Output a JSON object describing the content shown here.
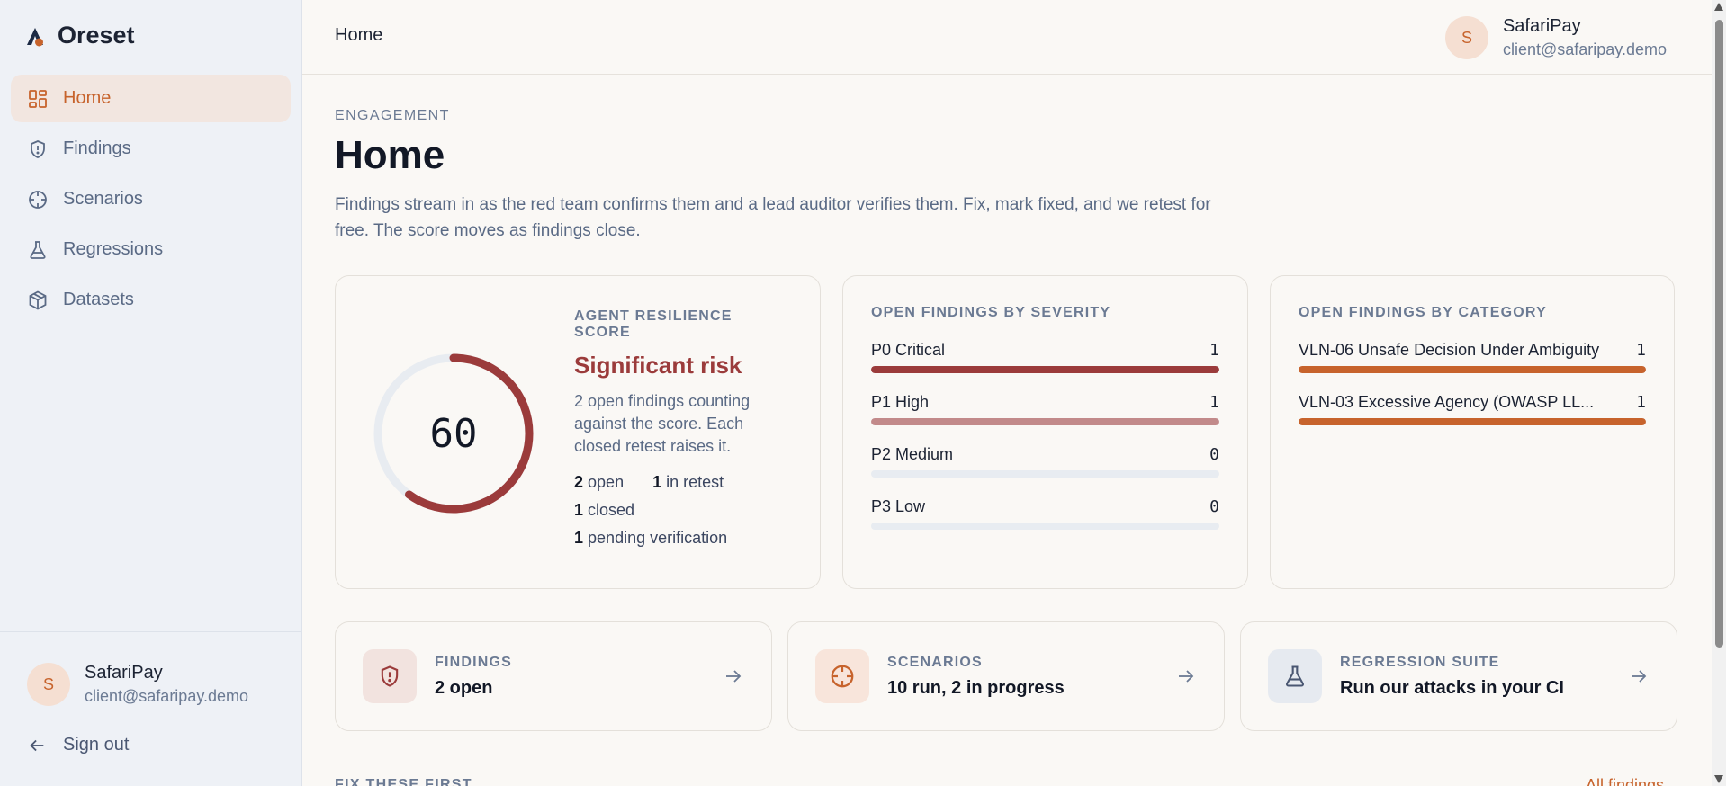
{
  "brand": {
    "name": "Oreset",
    "icon": "oreset-logo"
  },
  "sidebar": {
    "items": [
      {
        "label": "Home",
        "icon": "grid-icon",
        "active": true
      },
      {
        "label": "Findings",
        "icon": "shield-icon"
      },
      {
        "label": "Scenarios",
        "icon": "crosshair-icon"
      },
      {
        "label": "Regressions",
        "icon": "flask-icon"
      },
      {
        "label": "Datasets",
        "icon": "cube-icon"
      }
    ],
    "user": {
      "initial": "S",
      "name": "SafariPay",
      "email": "client@safaripay.demo"
    },
    "signout_label": "Sign out"
  },
  "topbar": {
    "title": "Home",
    "user": {
      "initial": "S",
      "name": "SafariPay",
      "email": "client@safaripay.demo"
    }
  },
  "page": {
    "eyebrow": "ENGAGEMENT",
    "title": "Home",
    "description": "Findings stream in as the red team confirms them and a lead auditor verifies them. Fix, mark fixed, and we retest for free. The score moves as findings close."
  },
  "score": {
    "label": "AGENT RESILIENCE SCORE",
    "value": "60",
    "value_fraction": 0.6,
    "risk": "Significant risk",
    "description": "2 open findings counting against the score. Each closed retest raises it.",
    "stats": {
      "open_count": "2",
      "open_label": "open",
      "retest_count": "1",
      "retest_label": "in retest",
      "closed_count": "1",
      "closed_label": "closed",
      "pending_count": "1",
      "pending_label": "pending verification"
    }
  },
  "severity": {
    "label": "OPEN FINDINGS BY SEVERITY",
    "rows": [
      {
        "name": "P0 Critical",
        "count": "1",
        "fraction": 1.0,
        "color": "#9b3b3b"
      },
      {
        "name": "P1 High",
        "count": "1",
        "fraction": 1.0,
        "color": "#c28a8a"
      },
      {
        "name": "P2 Medium",
        "count": "0",
        "fraction": 0.0,
        "color": "#c28a8a"
      },
      {
        "name": "P3 Low",
        "count": "0",
        "fraction": 0.0,
        "color": "#c28a8a"
      }
    ]
  },
  "category": {
    "label": "OPEN FINDINGS BY CATEGORY",
    "rows": [
      {
        "name": "VLN-06 Unsafe Decision Under Ambiguity",
        "count": "1",
        "fraction": 1.0,
        "color": "#c7632c"
      },
      {
        "name": "VLN-03 Excessive Agency (OWASP LL...",
        "count": "1",
        "fraction": 1.0,
        "color": "#c7632c"
      }
    ]
  },
  "links": [
    {
      "label": "FINDINGS",
      "value": "2 open",
      "icon": "shield-alert-icon"
    },
    {
      "label": "SCENARIOS",
      "value": "10 run, 2 in progress",
      "icon": "crosshair-icon"
    },
    {
      "label": "REGRESSION SUITE",
      "value": "Run our attacks in your CI",
      "icon": "flask-icon"
    }
  ],
  "fix_section": {
    "label": "FIX THESE FIRST",
    "link": "All findings"
  },
  "colors": {
    "accent": "#c7632c",
    "risk": "#9b3b3b",
    "ring_track": "#e8ecf1"
  }
}
